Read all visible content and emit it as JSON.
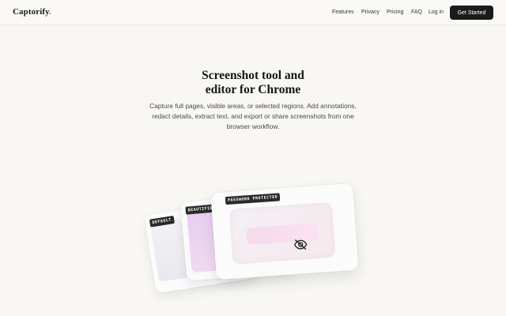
{
  "brand": {
    "name": "Captorify",
    "dot": "."
  },
  "nav": {
    "links": [
      "Features",
      "Privacy",
      "Pricing",
      "FAQ",
      "Log in"
    ],
    "cta": "Get Started"
  },
  "hero": {
    "title_line1": "Screenshot tool and",
    "title_line2": "editor for Chrome",
    "subtitle_line1": "Capture full pages, visible areas, or selected regions. Add annotations,",
    "subtitle_line2": "redact details, extract text, and export or share screenshots from one",
    "subtitle_line3": "browser workflow."
  },
  "cards": {
    "default_badge": "DEFAULT",
    "beautified_badge": "BEAUTIFIED",
    "protected_badge": "PASSWORD PROTECTED"
  },
  "icons": {
    "protected": "eye-slash-icon"
  },
  "colors": {
    "accent": "#d9542b",
    "cta_bg": "#1b1b1b",
    "page_bg": "#f8f7f3"
  }
}
